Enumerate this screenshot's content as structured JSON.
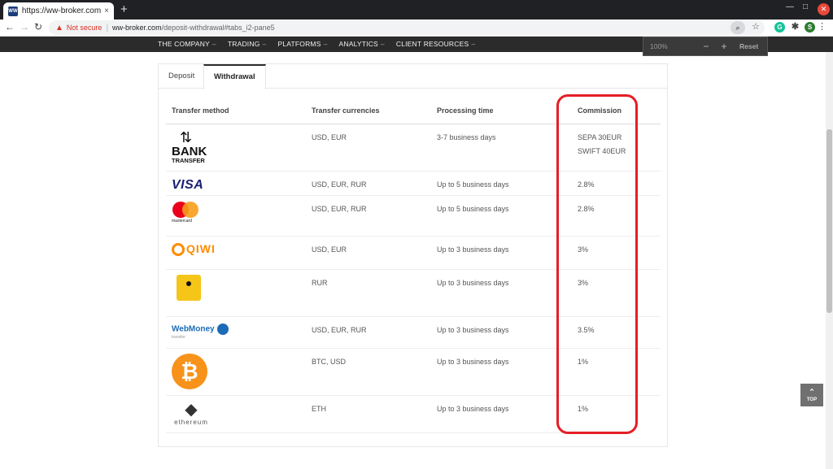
{
  "browser": {
    "tab_title": "https://ww-broker.com/d",
    "tab_close": "×",
    "new_tab": "+",
    "not_secure": "Not secure",
    "url_host": "ww-broker.com",
    "url_path": "/deposit-withdrawal#tabs_i2-pane5",
    "extension_avatar": "S"
  },
  "nav": {
    "items": [
      "THE COMPANY",
      "TRADING",
      "PLATFORMS",
      "ANALYTICS",
      "CLIENT RESOURCES"
    ]
  },
  "zoom": {
    "level": "100%",
    "minus": "−",
    "plus": "+",
    "reset": "Reset"
  },
  "tabs": {
    "deposit": "Deposit",
    "withdrawal": "Withdrawal",
    "active": "withdrawal"
  },
  "table": {
    "headers": [
      "Transfer method",
      "Transfer currencies",
      "Processing time",
      "Commission"
    ],
    "rows": [
      {
        "logo": "bank-transfer-logo",
        "logo_text": [
          "BANK",
          "TRANSFER"
        ],
        "currencies": "USD, EUR",
        "time": "3-7 business days",
        "commission": [
          "SEPA 30EUR",
          "SWIFT 40EUR"
        ]
      },
      {
        "logo": "visa-logo",
        "logo_text": [
          "VISA"
        ],
        "currencies": "USD, EUR, RUR",
        "time": "Up to 5 business days",
        "commission": [
          "2.8%"
        ]
      },
      {
        "logo": "mastercard-logo",
        "logo_text": [
          "mastercard"
        ],
        "currencies": "USD, EUR, RUR",
        "time": "Up to 5 business days",
        "commission": [
          "2.8%"
        ]
      },
      {
        "logo": "qiwi-logo",
        "logo_text": [
          "QIWI"
        ],
        "currencies": "USD, EUR",
        "time": "Up to 3 business days",
        "commission": [
          "3%"
        ]
      },
      {
        "logo": "yandex-money-logo",
        "logo_text": [],
        "currencies": "RUR",
        "time": "Up to 3 business days",
        "commission": [
          "3%"
        ]
      },
      {
        "logo": "webmoney-logo",
        "logo_text": [
          "WebMoney",
          "transfer"
        ],
        "currencies": "USD, EUR, RUR",
        "time": "Up to 3 business days",
        "commission": [
          "3.5%"
        ]
      },
      {
        "logo": "bitcoin-logo",
        "logo_text": [
          "₿"
        ],
        "currencies": "BTC, USD",
        "time": "Up to 3 business days",
        "commission": [
          "1%"
        ]
      },
      {
        "logo": "ethereum-logo",
        "logo_text": [
          "ethereum"
        ],
        "currencies": "ETH",
        "time": "Up to 3 business days",
        "commission": [
          "1%"
        ]
      }
    ]
  },
  "back_to_top": "TOP",
  "colors": {
    "highlight": "#e51e25",
    "nav_bg": "#2b2b2b"
  }
}
